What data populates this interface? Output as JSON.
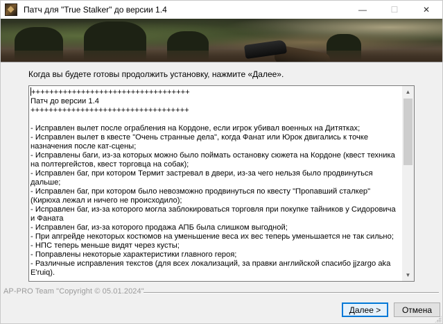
{
  "window": {
    "title": "Патч для \"True Stalker\" до версии 1.4",
    "icon": "stalker-app-icon",
    "controls": {
      "minimize": "—",
      "maximize": "☐",
      "close": "✕"
    }
  },
  "instruction": "Когда вы будете готовы продолжить установку, нажмите «Далее».",
  "info_text": "+++++++++++++++++++++++++++++++++++\nПатч до версии 1.4\n+++++++++++++++++++++++++++++++++++\n\n- Исправлен вылет после ограбления на Кордоне, если игрок убивал военных на Дитятках;\n- Исправлен вылет в квесте \"Очень странные дела\", когда Фанат или Юрок двигались к точке назначения после кат-сцены;\n- Исправлены баги, из-за которых можно было поймать остановку сюжета на Кордоне (квест техника на полтергейстов, квест торговца на собак);\n- Исправлен баг, при котором Термит застревал в двери, из-за чего нельзя было продвинуться дальше;\n- Исправлен баг, при котором было невозможно продвинуться по квесту \"Пропавший сталкер\" (Кирюха лежал и ничего не происходило);\n- Исправлен баг, из-за которого могла заблокироваться торговля при покупке тайников у Сидоровича и Фаната\n- Исправлен баг, из-за которого продажа АПБ была слишком выгодной;\n- При апгрейде некоторых костюмов на уменьшение веса их вес теперь уменьшается не так сильно;\n- НПС теперь меньше видят через кусты;\n- Поправлены некоторые характеристики главного героя;\n- Различные исправления текстов (для всех локализаций, за правки английской спасибо jjzargo aka E'ruiq).",
  "scrollbar": {
    "up_icon": "▲",
    "down_icon": "▼"
  },
  "footer": {
    "copyright": "AP-PRO Team \"Copyright © 05.01.2024\""
  },
  "buttons": {
    "next": "Далее >",
    "cancel": "Отмена"
  }
}
